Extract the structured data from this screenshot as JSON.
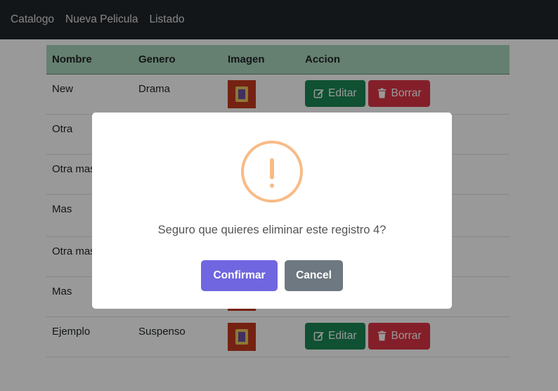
{
  "nav": {
    "items": [
      "Catalogo",
      "Nueva Pelicula",
      "Listado"
    ]
  },
  "table": {
    "headers": [
      "Nombre",
      "Genero",
      "Imagen",
      "Accion"
    ],
    "rows": [
      {
        "nombre": "New",
        "genero": "Drama"
      },
      {
        "nombre": "Otra",
        "genero": ""
      },
      {
        "nombre": "Otra mas",
        "genero": ""
      },
      {
        "nombre": "Mas",
        "genero": ""
      },
      {
        "nombre": "Otra mas",
        "genero": ""
      },
      {
        "nombre": "Mas",
        "genero": ""
      },
      {
        "nombre": "Ejemplo",
        "genero": "Suspenso"
      }
    ],
    "edit_label": "Editar",
    "delete_label": "Borrar"
  },
  "modal": {
    "message": "Seguro que quieres eliminar este registro 4?",
    "confirm_label": "Confirmar",
    "cancel_label": "Cancel",
    "icon": "warning-icon",
    "icon_color": "#f8bb86",
    "confirm_color": "#7066e0",
    "cancel_color": "#6e7881"
  },
  "colors": {
    "navbar": "#212529",
    "table_header": "#a8d5bb",
    "edit_button": "#198754",
    "delete_button": "#dc3545"
  }
}
